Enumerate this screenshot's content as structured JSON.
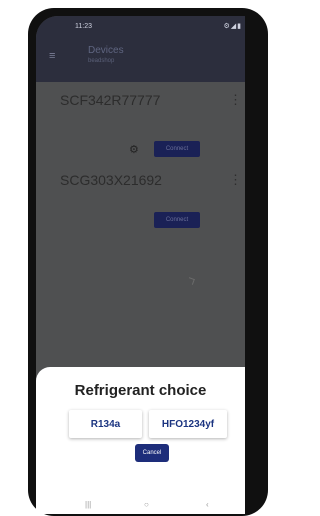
{
  "status_bar": {
    "time": "11:23",
    "icons": "⚙◢▮"
  },
  "appbar": {
    "title": "Devices",
    "subtitle": "beadshop",
    "menu_icon": "≡"
  },
  "devices": [
    {
      "name": "SCF342R77777",
      "connect_label": "Connect",
      "menu_icon": "⋮"
    },
    {
      "name": "SCG303X21692",
      "connect_label": "Connect",
      "menu_icon": "⋮"
    }
  ],
  "dialog": {
    "title": "Refrigerant choice",
    "options": [
      "R134a",
      "HFO1234yf"
    ],
    "cancel_label": "Cancel"
  },
  "navbar": {
    "recents": "|||",
    "home": "○",
    "back": "‹"
  }
}
